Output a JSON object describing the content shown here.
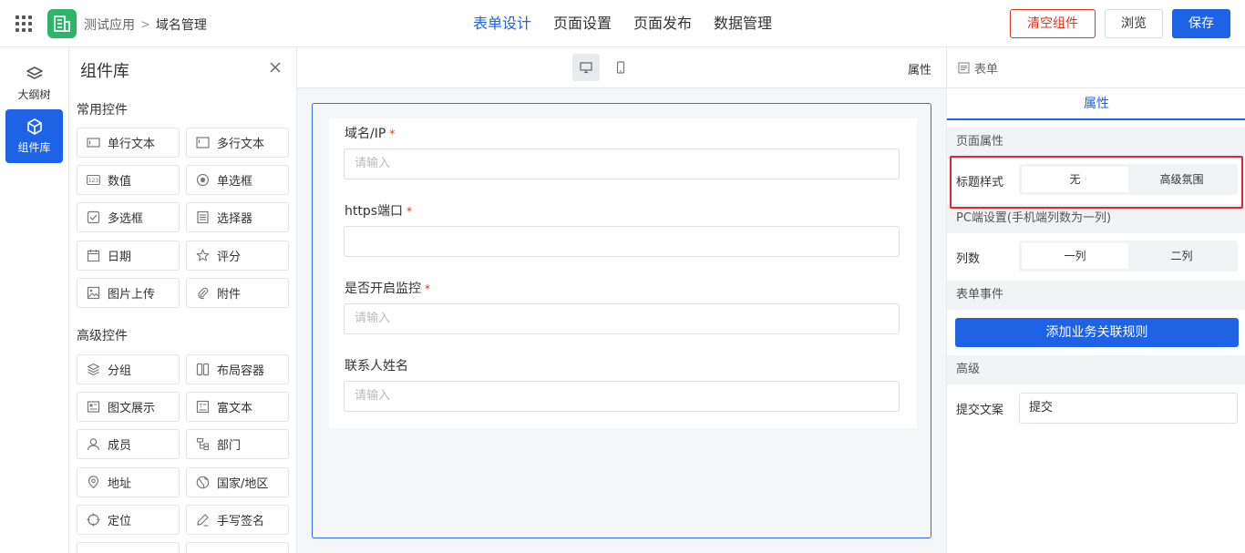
{
  "header": {
    "breadcrumb_app": "测试应用",
    "breadcrumb_sep": ">",
    "breadcrumb_current": "域名管理",
    "tabs": [
      {
        "label": "表单设计",
        "active": true
      },
      {
        "label": "页面设置",
        "active": false
      },
      {
        "label": "页面发布",
        "active": false
      },
      {
        "label": "数据管理",
        "active": false
      }
    ],
    "clear_label": "清空组件",
    "preview_label": "浏览",
    "save_label": "保存"
  },
  "rail": {
    "items": [
      {
        "label": "大纲树",
        "icon": "layers-icon",
        "active": false
      },
      {
        "label": "组件库",
        "icon": "cube-icon",
        "active": true
      }
    ]
  },
  "library": {
    "title": "组件库",
    "common_title": "常用控件",
    "common": [
      {
        "label": "单行文本",
        "icon": "single-line-text-icon"
      },
      {
        "label": "多行文本",
        "icon": "multi-line-text-icon"
      },
      {
        "label": "数值",
        "icon": "number-icon"
      },
      {
        "label": "单选框",
        "icon": "radio-icon"
      },
      {
        "label": "多选框",
        "icon": "checkbox-icon"
      },
      {
        "label": "选择器",
        "icon": "select-icon"
      },
      {
        "label": "日期",
        "icon": "calendar-icon"
      },
      {
        "label": "评分",
        "icon": "star-icon"
      },
      {
        "label": "图片上传",
        "icon": "image-icon"
      },
      {
        "label": "附件",
        "icon": "paperclip-icon"
      }
    ],
    "advanced_title": "高级控件",
    "advanced": [
      {
        "label": "分组",
        "icon": "group-icon"
      },
      {
        "label": "布局容器",
        "icon": "layout-icon"
      },
      {
        "label": "图文展示",
        "icon": "media-icon"
      },
      {
        "label": "富文本",
        "icon": "rich-text-icon"
      },
      {
        "label": "成员",
        "icon": "user-icon"
      },
      {
        "label": "部门",
        "icon": "department-icon"
      },
      {
        "label": "地址",
        "icon": "location-pin-icon"
      },
      {
        "label": "国家/地区",
        "icon": "globe-icon"
      },
      {
        "label": "定位",
        "icon": "crosshair-icon"
      },
      {
        "label": "手写签名",
        "icon": "pen-icon"
      }
    ]
  },
  "canvas": {
    "label": "属性",
    "fields": [
      {
        "label": "域名/IP",
        "required": true,
        "placeholder": "请输入"
      },
      {
        "label": "https端口",
        "required": true,
        "placeholder": ""
      },
      {
        "label": "是否开启监控",
        "required": true,
        "placeholder": "请输入"
      },
      {
        "label": "联系人姓名",
        "required": false,
        "placeholder": "请输入"
      }
    ],
    "required_mark": "*"
  },
  "right_panel": {
    "header": "表单",
    "tab": "属性",
    "page_props_title": "页面属性",
    "title_style_label": "标题样式",
    "title_style_options": [
      {
        "label": "无",
        "selected": true
      },
      {
        "label": "高级氛围",
        "selected": false
      }
    ],
    "pc_settings_title": "PC端设置(手机端列数为一列)",
    "columns_label": "列数",
    "columns_options": [
      {
        "label": "一列",
        "selected": true
      },
      {
        "label": "二列",
        "selected": false
      }
    ],
    "form_events_title": "表单事件",
    "add_rule_label": "添加业务关联规则",
    "advanced_title": "高级",
    "submit_text_label": "提交文案",
    "submit_text_value": "提交"
  },
  "colors": {
    "primary": "#1e62e6",
    "danger": "#d9381e",
    "logo_green": "#2fb56a",
    "highlight_red": "#e8262a"
  }
}
